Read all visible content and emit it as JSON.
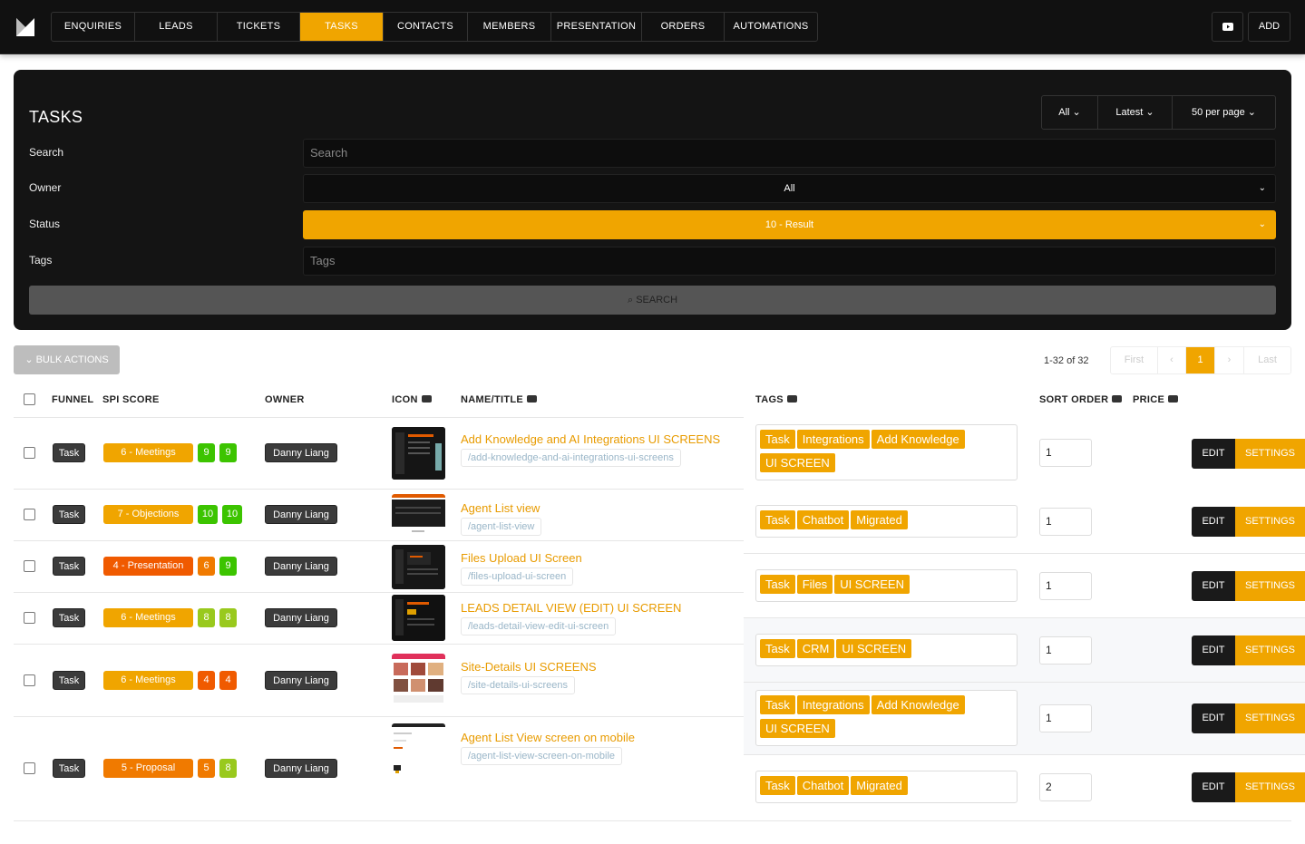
{
  "nav": {
    "tabs": [
      "ENQUIRIES",
      "LEADS",
      "TICKETS",
      "TASKS",
      "CONTACTS",
      "MEMBERS",
      "PRESENTATION",
      "ORDERS",
      "AUTOMATIONS"
    ],
    "active": "TASKS",
    "add_label": "ADD"
  },
  "panel": {
    "title": "TASKS",
    "filter_all": "All",
    "sort": "Latest",
    "per_page": "50 per page",
    "search_label": "Search",
    "search_placeholder": "Search",
    "owner_label": "Owner",
    "owner_value": "All",
    "status_label": "Status",
    "status_value": "10 - Result",
    "tags_label": "Tags",
    "tags_placeholder": "Tags",
    "search_button": "SEARCH"
  },
  "list": {
    "bulk_actions": "BULK ACTIONS",
    "count": "1-32 of 32",
    "pager": [
      "First",
      "‹",
      "1",
      "›",
      "Last"
    ]
  },
  "columns": {
    "funnel": "FUNNEL",
    "spi": "SPI SCORE",
    "owner": "OWNER",
    "icon": "ICON",
    "name": "NAME/TITLE",
    "tags": "TAGS",
    "sort": "SORT ORDER",
    "price": "PRICE"
  },
  "buttons": {
    "edit": "EDIT",
    "settings": "SETTINGS"
  },
  "rows": [
    {
      "funnel": "Task",
      "spi": "6 - Meetings",
      "s1": "9",
      "s2": "9",
      "owner": "Danny Liang",
      "title": "Add Knowledge and AI Integrations UI SCREENS",
      "slug": "/add-knowledge-and-ai-integrations-ui-screens"
    },
    {
      "funnel": "Task",
      "spi": "7 - Objections",
      "s1": "10",
      "s2": "10",
      "owner": "Danny Liang",
      "title": "Agent List view",
      "slug": "/agent-list-view"
    },
    {
      "funnel": "Task",
      "spi": "4 - Presentation",
      "s1": "6",
      "s2": "9",
      "owner": "Danny Liang",
      "title": "Files Upload UI Screen",
      "slug": "/files-upload-ui-screen"
    },
    {
      "funnel": "Task",
      "spi": "6 - Meetings",
      "s1": "8",
      "s2": "8",
      "owner": "Danny Liang",
      "title": "LEADS DETAIL VIEW (EDIT) UI SCREEN",
      "slug": "/leads-detail-view-edit-ui-screen"
    },
    {
      "funnel": "Task",
      "spi": "6 - Meetings",
      "s1": "4",
      "s2": "4",
      "owner": "Danny Liang",
      "title": "Site-Details UI SCREENS",
      "slug": "/site-details-ui-screens"
    },
    {
      "funnel": "Task",
      "spi": "5 - Proposal",
      "s1": "5",
      "s2": "8",
      "owner": "Danny Liang",
      "title": "Agent List View screen on mobile",
      "slug": "/agent-list-view-screen-on-mobile"
    }
  ],
  "tag_rows": [
    {
      "tags": [
        "Task",
        "Integrations",
        "Add Knowledge",
        "UI SCREEN"
      ],
      "sort": "1"
    },
    {
      "tags": [
        "Task",
        "Chatbot",
        "Migrated"
      ],
      "sort": "1"
    },
    {
      "tags": [
        "Task",
        "Files",
        "UI SCREEN"
      ],
      "sort": "1"
    },
    {
      "tags": [
        "Task",
        "CRM",
        "UI SCREEN"
      ],
      "sort": "1"
    },
    {
      "tags": [
        "Task",
        "Integrations",
        "Add Knowledge",
        "UI SCREEN"
      ],
      "sort": "1"
    },
    {
      "tags": [
        "Task",
        "Chatbot",
        "Migrated"
      ],
      "sort": "2"
    }
  ]
}
